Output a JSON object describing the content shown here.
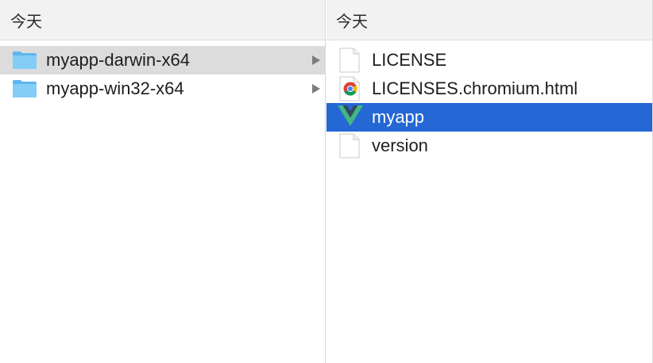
{
  "left_column": {
    "header": "今天",
    "items": [
      {
        "label": "myapp-darwin-x64",
        "icon": "folder-icon",
        "state": "highlighted"
      },
      {
        "label": "myapp-win32-x64",
        "icon": "folder-icon",
        "state": "normal"
      }
    ]
  },
  "right_column": {
    "header": "今天",
    "items": [
      {
        "label": "LICENSE",
        "icon": "file-icon"
      },
      {
        "label": "LICENSES.chromium.html",
        "icon": "chrome-html-icon"
      },
      {
        "label": "myapp",
        "icon": "vue-app-icon",
        "state": "selected"
      },
      {
        "label": "version",
        "icon": "file-icon"
      }
    ]
  },
  "colors": {
    "selection": "#2467d5",
    "highlight": "#dcdcdc",
    "folder": "#6fc2f3",
    "vue_green": "#41b883",
    "vue_dark": "#35495e"
  }
}
